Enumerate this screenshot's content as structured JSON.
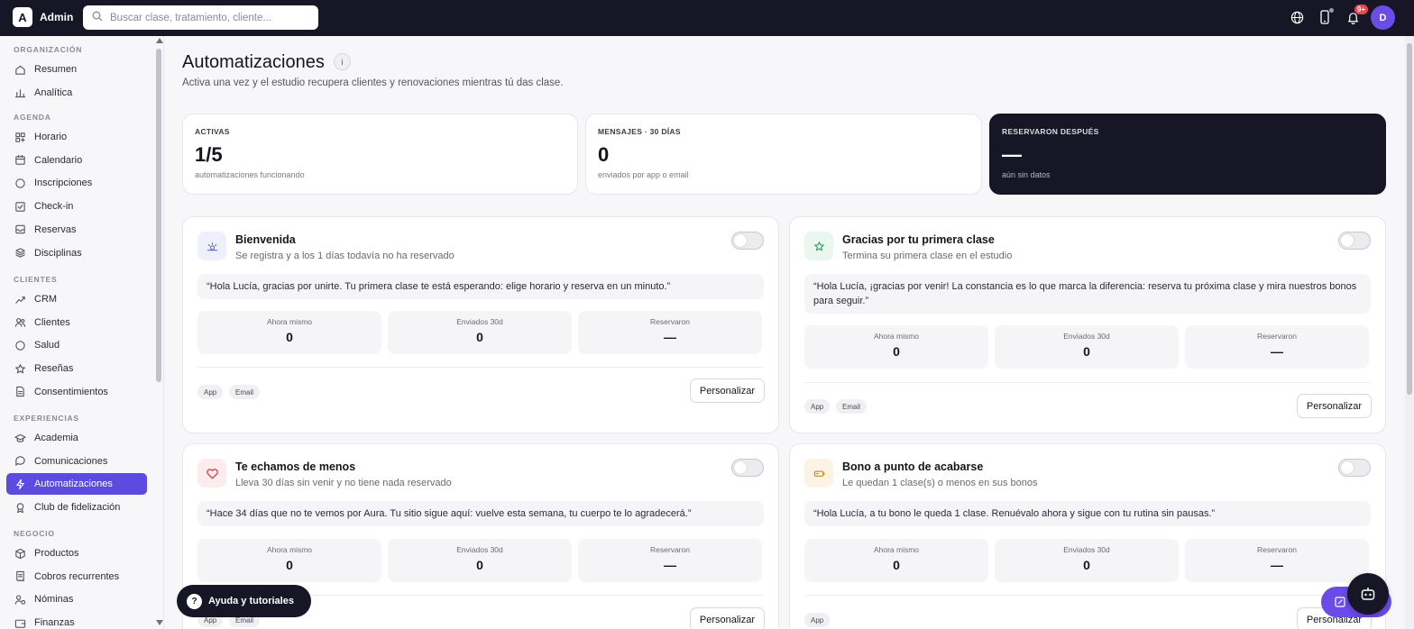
{
  "app": {
    "logo_letter": "A",
    "brand": "Admin"
  },
  "search": {
    "placeholder": "Buscar clase, tratamiento, cliente..."
  },
  "topbar": {
    "notifications_badge": "9+",
    "avatar_initial": "D"
  },
  "sidebar": {
    "sections": [
      {
        "title": "ORGANIZACIÓN",
        "items": [
          {
            "label": "Resumen",
            "icon": "home-icon"
          },
          {
            "label": "Analítica",
            "icon": "bar-chart-icon"
          }
        ]
      },
      {
        "title": "AGENDA",
        "items": [
          {
            "label": "Horario",
            "icon": "grid-icon"
          },
          {
            "label": "Calendario",
            "icon": "calendar-icon"
          },
          {
            "label": "Inscripciones",
            "icon": "circle-icon"
          },
          {
            "label": "Check-in",
            "icon": "check-square-icon"
          },
          {
            "label": "Reservas",
            "icon": "inbox-icon"
          },
          {
            "label": "Disciplinas",
            "icon": "layers-icon"
          }
        ]
      },
      {
        "title": "CLIENTES",
        "items": [
          {
            "label": "CRM",
            "icon": "trend-icon"
          },
          {
            "label": "Clientes",
            "icon": "users-icon"
          },
          {
            "label": "Salud",
            "icon": "circle-icon"
          },
          {
            "label": "Reseñas",
            "icon": "star-icon"
          },
          {
            "label": "Consentimientos",
            "icon": "file-icon"
          }
        ]
      },
      {
        "title": "EXPERIENCIAS",
        "items": [
          {
            "label": "Academia",
            "icon": "graduation-cap-icon"
          },
          {
            "label": "Comunicaciones",
            "icon": "chat-icon"
          },
          {
            "label": "Automatizaciones",
            "icon": "lightning-icon",
            "active": true
          },
          {
            "label": "Club de fidelización",
            "icon": "award-icon"
          }
        ]
      },
      {
        "title": "NEGOCIO",
        "items": [
          {
            "label": "Productos",
            "icon": "package-icon"
          },
          {
            "label": "Cobros recurrentes",
            "icon": "receipt-icon"
          },
          {
            "label": "Nóminas",
            "icon": "user-money-icon"
          },
          {
            "label": "Finanzas",
            "icon": "wallet-icon"
          }
        ]
      }
    ]
  },
  "header": {
    "title": "Automatizaciones",
    "info_icon": "i",
    "subtitle": "Activa una vez y el estudio recupera clientes y renovaciones mientras tú das clase."
  },
  "stats": [
    {
      "label": "ACTIVAS",
      "value": "1/5",
      "hint": "automatizaciones funcionando"
    },
    {
      "label": "MENSAJES · 30 DÍAS",
      "value": "0",
      "hint": "enviados por app o email"
    },
    {
      "label": "RESERVARON DESPUÉS",
      "value": "—",
      "hint": "aún sin datos"
    }
  ],
  "metric_labels": [
    "Ahora mismo",
    "Enviados 30d",
    "Reservaron"
  ],
  "automations": [
    {
      "icon": "sun-icon",
      "accent": "#eef0fb",
      "title": "Bienvenida",
      "subtitle": "Se registra y a los 1 días todavía no ha reservado",
      "message": "“Hola Lucía, gracias por unirte. Tu primera clase te está esperando: elige horario y reserva en un minuto.”",
      "metrics": [
        "0",
        "0",
        "—"
      ],
      "channels": [
        "App",
        "Email"
      ],
      "button": "Personalizar",
      "enabled": false
    },
    {
      "icon": "star-icon",
      "accent": "#e9f7ef",
      "title": "Gracias por tu primera clase",
      "subtitle": "Termina su primera clase en el estudio",
      "message": "“Hola Lucía, ¡gracias por venir! La constancia es lo que marca la diferencia: reserva tu próxima clase y mira nuestros bonos para seguir.”",
      "metrics": [
        "0",
        "0",
        "—"
      ],
      "channels": [
        "App",
        "Email"
      ],
      "button": "Personalizar",
      "enabled": false
    },
    {
      "icon": "heart-icon",
      "accent": "#fdecee",
      "title": "Te echamos de menos",
      "subtitle": "Lleva 30 días sin venir y no tiene nada reservado",
      "message": "“Hace 34 días que no te vemos por Aura. Tu sitio sigue aquí: vuelve esta semana, tu cuerpo te lo agradecerá.”",
      "metrics": [
        "0",
        "0",
        "—"
      ],
      "channels": [
        "App",
        "Email"
      ],
      "button": "Personalizar",
      "enabled": false
    },
    {
      "icon": "battery-icon",
      "accent": "#fdf3e4",
      "title": "Bono a punto de acabarse",
      "subtitle": "Le quedan 1 clase(s) o menos en sus bonos",
      "message": "“Hola Lucía, a tu bono le queda 1 clase. Renuévalo ahora y sigue con tu rutina sin pausas.”",
      "metrics": [
        "0",
        "0",
        "—"
      ],
      "channels": [
        "App"
      ],
      "button": "Personalizar",
      "enabled": false
    }
  ],
  "help": {
    "icon": "?",
    "label": "Ayuda y tutoriales"
  },
  "colors": {
    "topbar": "#161626",
    "accent": "#5b4be0",
    "danger": "#e5484d"
  }
}
